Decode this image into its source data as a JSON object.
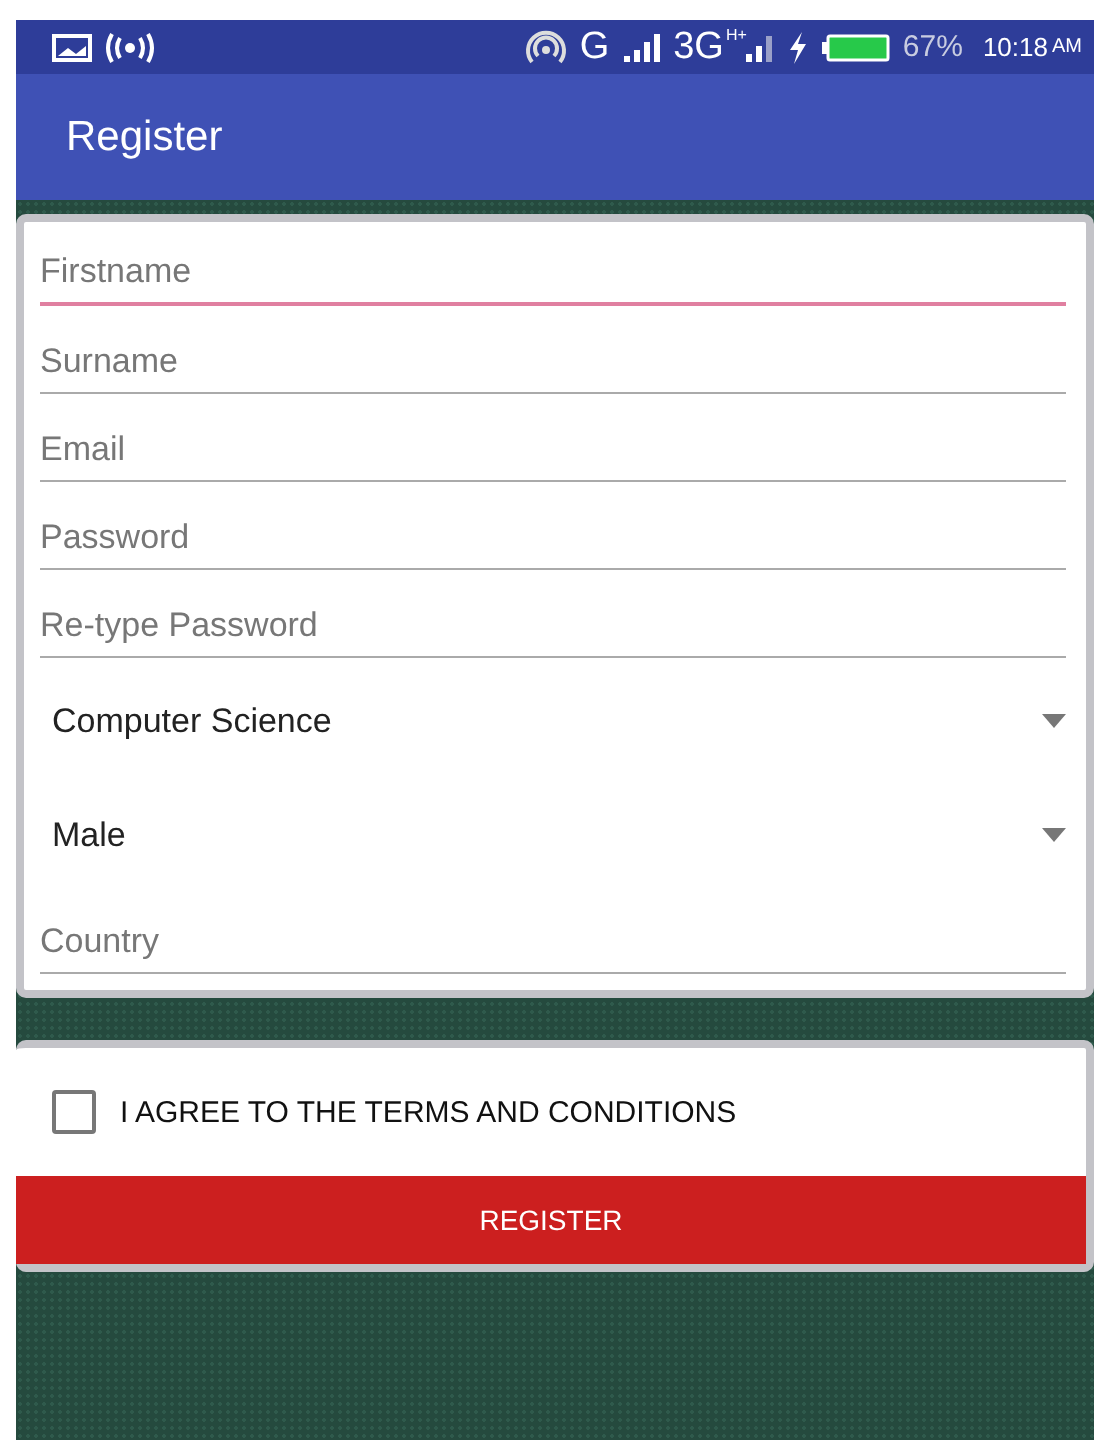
{
  "status_bar": {
    "network": "G",
    "network_2": "3G",
    "network_2_badge": "H+",
    "battery": "67%",
    "time": "10:18",
    "time_suffix": "AM"
  },
  "app_bar": {
    "title": "Register"
  },
  "form": {
    "fields": [
      {
        "kind": "text",
        "placeholder": "Firstname",
        "focused": true
      },
      {
        "kind": "text",
        "placeholder": "Surname",
        "focused": false
      },
      {
        "kind": "text",
        "placeholder": "Email",
        "focused": false
      },
      {
        "kind": "text",
        "placeholder": "Password",
        "focused": false
      },
      {
        "kind": "text",
        "placeholder": "Re-type Password",
        "focused": false
      },
      {
        "kind": "dropdown",
        "value": "Computer Science"
      },
      {
        "kind": "dropdown",
        "value": "Male"
      },
      {
        "kind": "text",
        "placeholder": "Country",
        "focused": false
      }
    ]
  },
  "terms": {
    "label": "I AGREE TO THE TERMS AND CONDITIONS",
    "checked": false
  },
  "button": "REGISTER"
}
